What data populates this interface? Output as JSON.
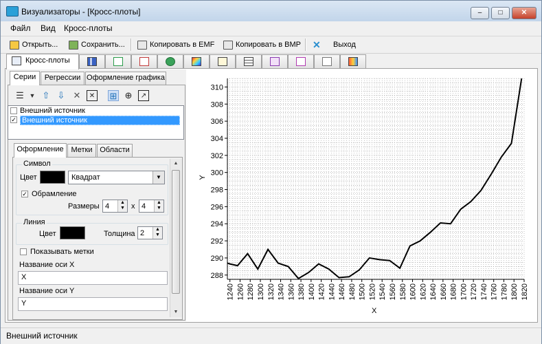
{
  "window": {
    "title": "Визуализаторы - [Кросс-плоты]"
  },
  "menu": [
    "Файл",
    "Вид",
    "Кросс-плоты"
  ],
  "toolbar": {
    "open": "Открыть...",
    "save": "Сохранить...",
    "copy_emf": "Копировать в EMF",
    "copy_bmp": "Копировать в BMP",
    "exit": "Выход"
  },
  "main_tabs": {
    "active_label": "Кросс-плоты",
    "icons": [
      "crossplot-icon",
      "bar-chart-icon",
      "scatter-icon",
      "line-chart-icon",
      "pie-3d-icon",
      "heatmap-icon",
      "document-chart-icon",
      "table-grid-icon",
      "dot-matrix-icon",
      "multi-line-icon",
      "histogram-icon",
      "palette-icon"
    ]
  },
  "left": {
    "tabs": [
      "Серии",
      "Регрессии",
      "Оформление графика"
    ],
    "series": [
      {
        "label": "Внешний источник",
        "checked": false,
        "selected": false
      },
      {
        "label": "Внешний источник",
        "checked": true,
        "selected": true
      }
    ],
    "style_tabs": [
      "Оформление",
      "Метки",
      "Области"
    ],
    "symbol": {
      "group": "Символ",
      "color_label": "Цвет",
      "shape": "Квадрат",
      "border_label": "Обрамление",
      "border_checked": true,
      "size_label": "Размеры",
      "size_w": "4",
      "size_x": "x",
      "size_h": "4"
    },
    "line": {
      "group": "Линия",
      "color_label": "Цвет",
      "width_label": "Толщина",
      "width": "2"
    },
    "show_labels": {
      "label": "Показывать метки",
      "checked": false
    },
    "axis_x": {
      "label": "Название оси X",
      "value": "X"
    },
    "axis_y": {
      "label": "Название оси Y",
      "value": "Y"
    }
  },
  "status": "Внешний источник",
  "chart_data": {
    "type": "line",
    "xlabel": "X",
    "ylabel": "Y",
    "xlim": [
      1235,
      1820
    ],
    "ylim": [
      287.5,
      311
    ],
    "x_ticks": [
      1240,
      1260,
      1280,
      1300,
      1320,
      1340,
      1360,
      1380,
      1400,
      1420,
      1440,
      1460,
      1480,
      1500,
      1520,
      1540,
      1560,
      1580,
      1600,
      1620,
      1640,
      1660,
      1680,
      1700,
      1720,
      1740,
      1760,
      1780,
      1800,
      1820
    ],
    "y_ticks": [
      288,
      290,
      292,
      294,
      296,
      298,
      300,
      302,
      304,
      306,
      308,
      310
    ],
    "grid": true,
    "series": [
      {
        "color": "#000000",
        "values": [
          [
            1235,
            289.4
          ],
          [
            1240,
            289.3
          ],
          [
            1255,
            289.1
          ],
          [
            1275,
            290.5
          ],
          [
            1295,
            288.7
          ],
          [
            1315,
            291.0
          ],
          [
            1335,
            289.4
          ],
          [
            1355,
            289.0
          ],
          [
            1375,
            287.6
          ],
          [
            1395,
            288.3
          ],
          [
            1415,
            289.3
          ],
          [
            1435,
            288.7
          ],
          [
            1455,
            287.7
          ],
          [
            1475,
            287.8
          ],
          [
            1495,
            288.6
          ],
          [
            1515,
            290.0
          ],
          [
            1535,
            289.8
          ],
          [
            1555,
            289.7
          ],
          [
            1575,
            288.8
          ],
          [
            1595,
            291.4
          ],
          [
            1615,
            292.0
          ],
          [
            1635,
            293.0
          ],
          [
            1655,
            294.1
          ],
          [
            1675,
            294.0
          ],
          [
            1695,
            295.7
          ],
          [
            1715,
            296.6
          ],
          [
            1735,
            297.9
          ],
          [
            1755,
            299.8
          ],
          [
            1775,
            301.8
          ],
          [
            1795,
            303.4
          ],
          [
            1815,
            311.0
          ]
        ]
      }
    ]
  }
}
